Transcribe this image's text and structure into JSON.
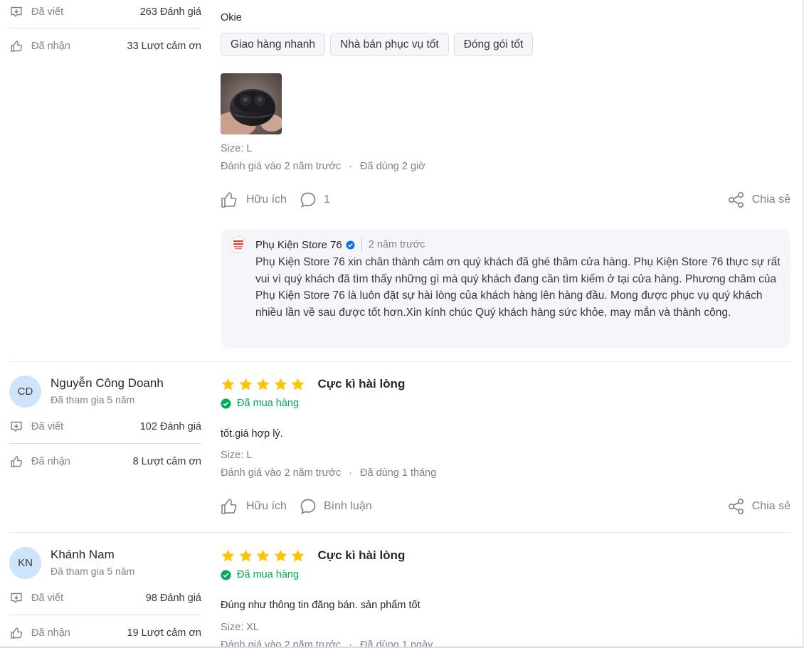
{
  "review1": {
    "written_label": "Đã viết",
    "written_value": "263 Đánh giá",
    "received_label": "Đã nhận",
    "received_value": "33 Lượt cảm ơn",
    "comment": "Okie",
    "chips": [
      "Giao hàng nhanh",
      "Nhà bán phục vụ tốt",
      "Đóng gói tốt"
    ],
    "size": "Size: L",
    "time": "Đánh giá vào 2 năm trước",
    "usage": "Đã dùng 2 giờ",
    "helpful": "Hữu ích",
    "comments_count": "1",
    "share": "Chia sẻ",
    "reply": {
      "shop_name": "Phụ Kiện Store 76",
      "time": "2 năm trước",
      "body": "Phụ Kiện Store 76 xin chân thành cảm ơn quý khách đã ghé thăm cửa hàng. Phụ Kiện Store 76 thực sự rất vui vì quý khách đã tìm thấy những gì mà quý khách đang cần tìm kiếm ở tại cửa hàng. Phương châm của Phụ Kiện Store 76 là luôn đặt sự hài lòng của khách hàng lên hàng đầu. Mong được phục vụ quý khách nhiều lần về sau được tốt hơn.Xin kính chúc Quý khách hàng sức khỏe, may mắn và thành công."
    }
  },
  "review2": {
    "initials": "CD",
    "name": "Nguyễn Công Doanh",
    "joined": "Đã tham gia 5 năm",
    "written_label": "Đã viết",
    "written_value": "102 Đánh giá",
    "received_label": "Đã nhận",
    "received_value": "8 Lượt cảm ơn",
    "rating": 5,
    "rating_title": "Cực kì hài lòng",
    "bought": "Đã mua hàng",
    "comment": "tốt.giá hợp lý.",
    "size": "Size: L",
    "time": "Đánh giá vào 2 năm trước",
    "usage": "Đã dùng 1 tháng",
    "helpful": "Hữu ích",
    "comment_action": "Bình luận",
    "share": "Chia sẻ"
  },
  "review3": {
    "initials": "KN",
    "name": "Khánh Nam",
    "joined": "Đã tham gia 5 năm",
    "written_label": "Đã viết",
    "written_value": "98 Đánh giá",
    "received_label": "Đã nhận",
    "received_value": "19 Lượt cảm ơn",
    "rating": 5,
    "rating_title": "Cực kì hài lòng",
    "bought": "Đã mua hàng",
    "comment": "Đúng như thông tin đăng bán. sản phẩm tốt",
    "size": "Size: XL",
    "time": "Đánh giá vào 2 năm trước",
    "usage": "Đã dùng 1 ngày"
  },
  "colors": {
    "star": "#ffc400",
    "bought_green": "#00ab56",
    "verified_blue": "#0b74e5",
    "avatar_bg": "#cfe3fb"
  }
}
